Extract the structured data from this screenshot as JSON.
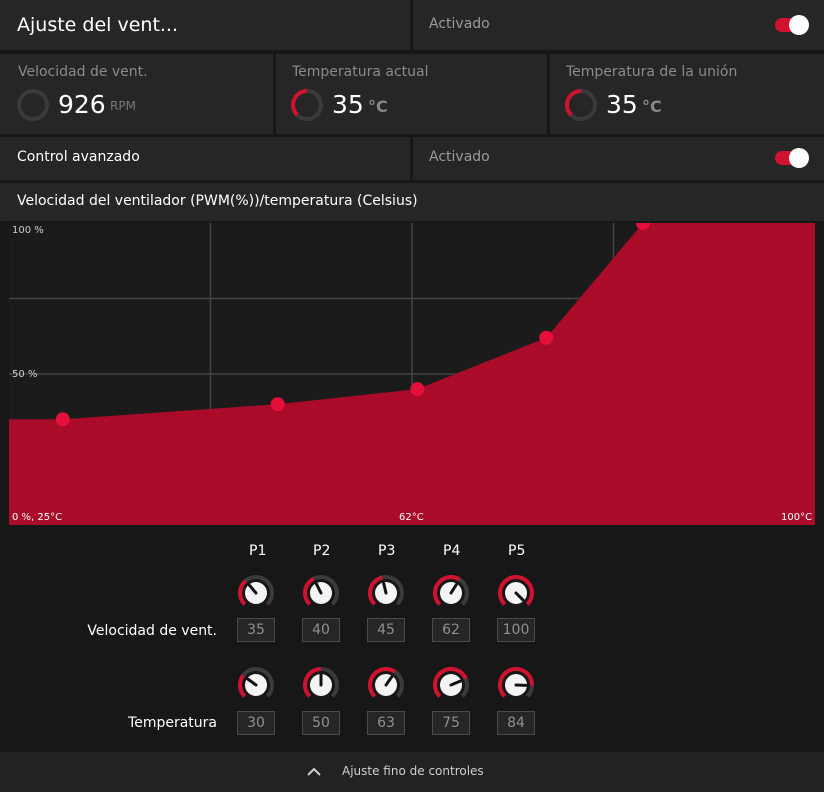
{
  "header": {
    "title": "Ajuste del vent...",
    "status": "Activado",
    "toggle_on": true
  },
  "stats": [
    {
      "label": "Velocidad de vent.",
      "value": "926",
      "unit": "RPM",
      "level": 0.0
    },
    {
      "label": "Temperatura actual",
      "value": "35",
      "unit": "°C",
      "level": 0.35
    },
    {
      "label": "Temperatura de la unión",
      "value": "35",
      "unit": "°C",
      "level": 0.35
    }
  ],
  "advanced": {
    "label": "Control avanzado",
    "status": "Activado",
    "toggle_on": true
  },
  "curve": {
    "title": "Velocidad del ventilador (PWM(%))/temperatura (Celsius)",
    "y_top": "100 %",
    "y_mid": "50 %",
    "origin": "0 %, 25°C",
    "x_mid": "62°C",
    "x_max": "100°C"
  },
  "chart_data": {
    "type": "area",
    "title": "Velocidad del ventilador (PWM(%))/temperatura (Celsius)",
    "xlabel": "",
    "ylabel": "",
    "xlim": [
      25,
      100
    ],
    "ylim": [
      0,
      100
    ],
    "x": [
      30,
      50,
      63,
      75,
      84
    ],
    "y": [
      35,
      40,
      45,
      62,
      100
    ]
  },
  "points": {
    "labels": [
      "P1",
      "P2",
      "P3",
      "P4",
      "P5"
    ],
    "speed_label": "Velocidad de vent.",
    "temp_label": "Temperatura",
    "speed": [
      "35",
      "40",
      "45",
      "62",
      "100"
    ],
    "temp": [
      "30",
      "50",
      "63",
      "75",
      "84"
    ]
  },
  "footer": {
    "label": "Ajuste fino de controles",
    "icon": "chevron-up-icon"
  },
  "colors": {
    "accent": "#d0122e",
    "fill": "#a90b28",
    "panel": "#262626",
    "background": "#171717"
  }
}
